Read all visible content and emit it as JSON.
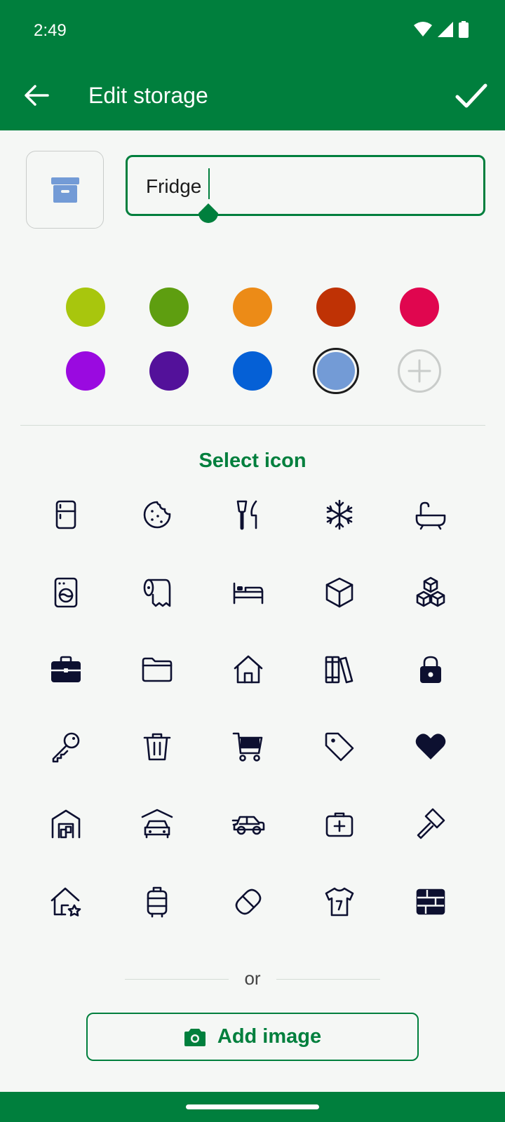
{
  "status": {
    "time": "2:49"
  },
  "appbar": {
    "title": "Edit storage"
  },
  "name_field": {
    "value": "Fridge"
  },
  "colors": {
    "swatches": [
      "#a8c60d",
      "#5e9e10",
      "#ec8b17",
      "#bf3205",
      "#e0064f",
      "#9a0ae0",
      "#53119a",
      "#0560d6",
      "#739bd6"
    ],
    "selected": "#739bd6",
    "accent": "#007f3d"
  },
  "icons_section": {
    "title": "Select icon",
    "icons": [
      "fridge-icon",
      "cookie-icon",
      "utensils-icon",
      "snowflake-icon",
      "bathtub-icon",
      "washing-machine-icon",
      "paper-towel-icon",
      "bed-icon",
      "box-icon",
      "boxes-icon",
      "briefcase-icon",
      "folder-icon",
      "house-icon",
      "books-icon",
      "lock-icon",
      "key-icon",
      "trash-icon",
      "cart-icon",
      "tag-icon",
      "heart-icon",
      "warehouse-icon",
      "garage-icon",
      "car-side-icon",
      "first-aid-kit-icon",
      "hammer-icon",
      "house-star-icon",
      "suitcase-icon",
      "pill-icon",
      "tshirt-icon",
      "brick-wall-icon"
    ]
  },
  "or_text": "or",
  "add_image_label": "Add image"
}
